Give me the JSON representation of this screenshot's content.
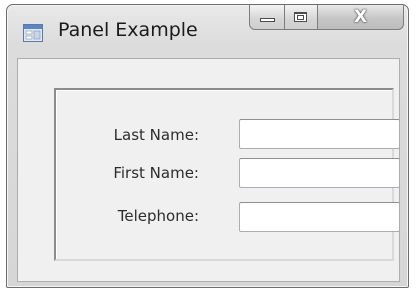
{
  "window": {
    "title": "Panel Example",
    "icon": "form-window-icon",
    "controls": {
      "minimize": "minimize-icon",
      "maximize": "maximize-icon",
      "close": "close-icon",
      "close_glyph": "X"
    }
  },
  "form": {
    "fields": [
      {
        "label": "Last Name:",
        "value": ""
      },
      {
        "label": "First Name:",
        "value": ""
      },
      {
        "label": "Telephone:",
        "value": ""
      }
    ]
  }
}
